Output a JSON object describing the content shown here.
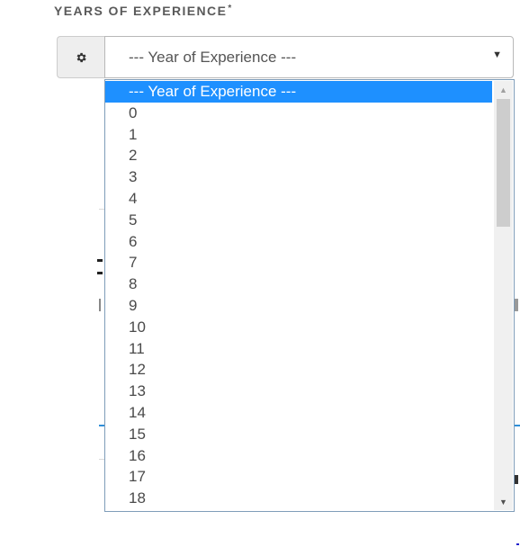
{
  "field": {
    "label": "YEARS OF EXPERIENCE",
    "required_mark": "*",
    "addon_icon": "gear-icon"
  },
  "select": {
    "value": "--- Year of Experience ---",
    "caret": "▼"
  },
  "dropdown": {
    "options": [
      "--- Year of Experience ---",
      "0",
      "1",
      "2",
      "3",
      "4",
      "5",
      "6",
      "7",
      "8",
      "9",
      "10",
      "11",
      "12",
      "13",
      "14",
      "15",
      "16",
      "17",
      "18"
    ],
    "selected_index": 0,
    "scroll_up": "▲",
    "scroll_down": "▼"
  },
  "colors": {
    "highlight": "#1e90ff",
    "label": "#5a5a5a",
    "border": "#7f9db9"
  }
}
